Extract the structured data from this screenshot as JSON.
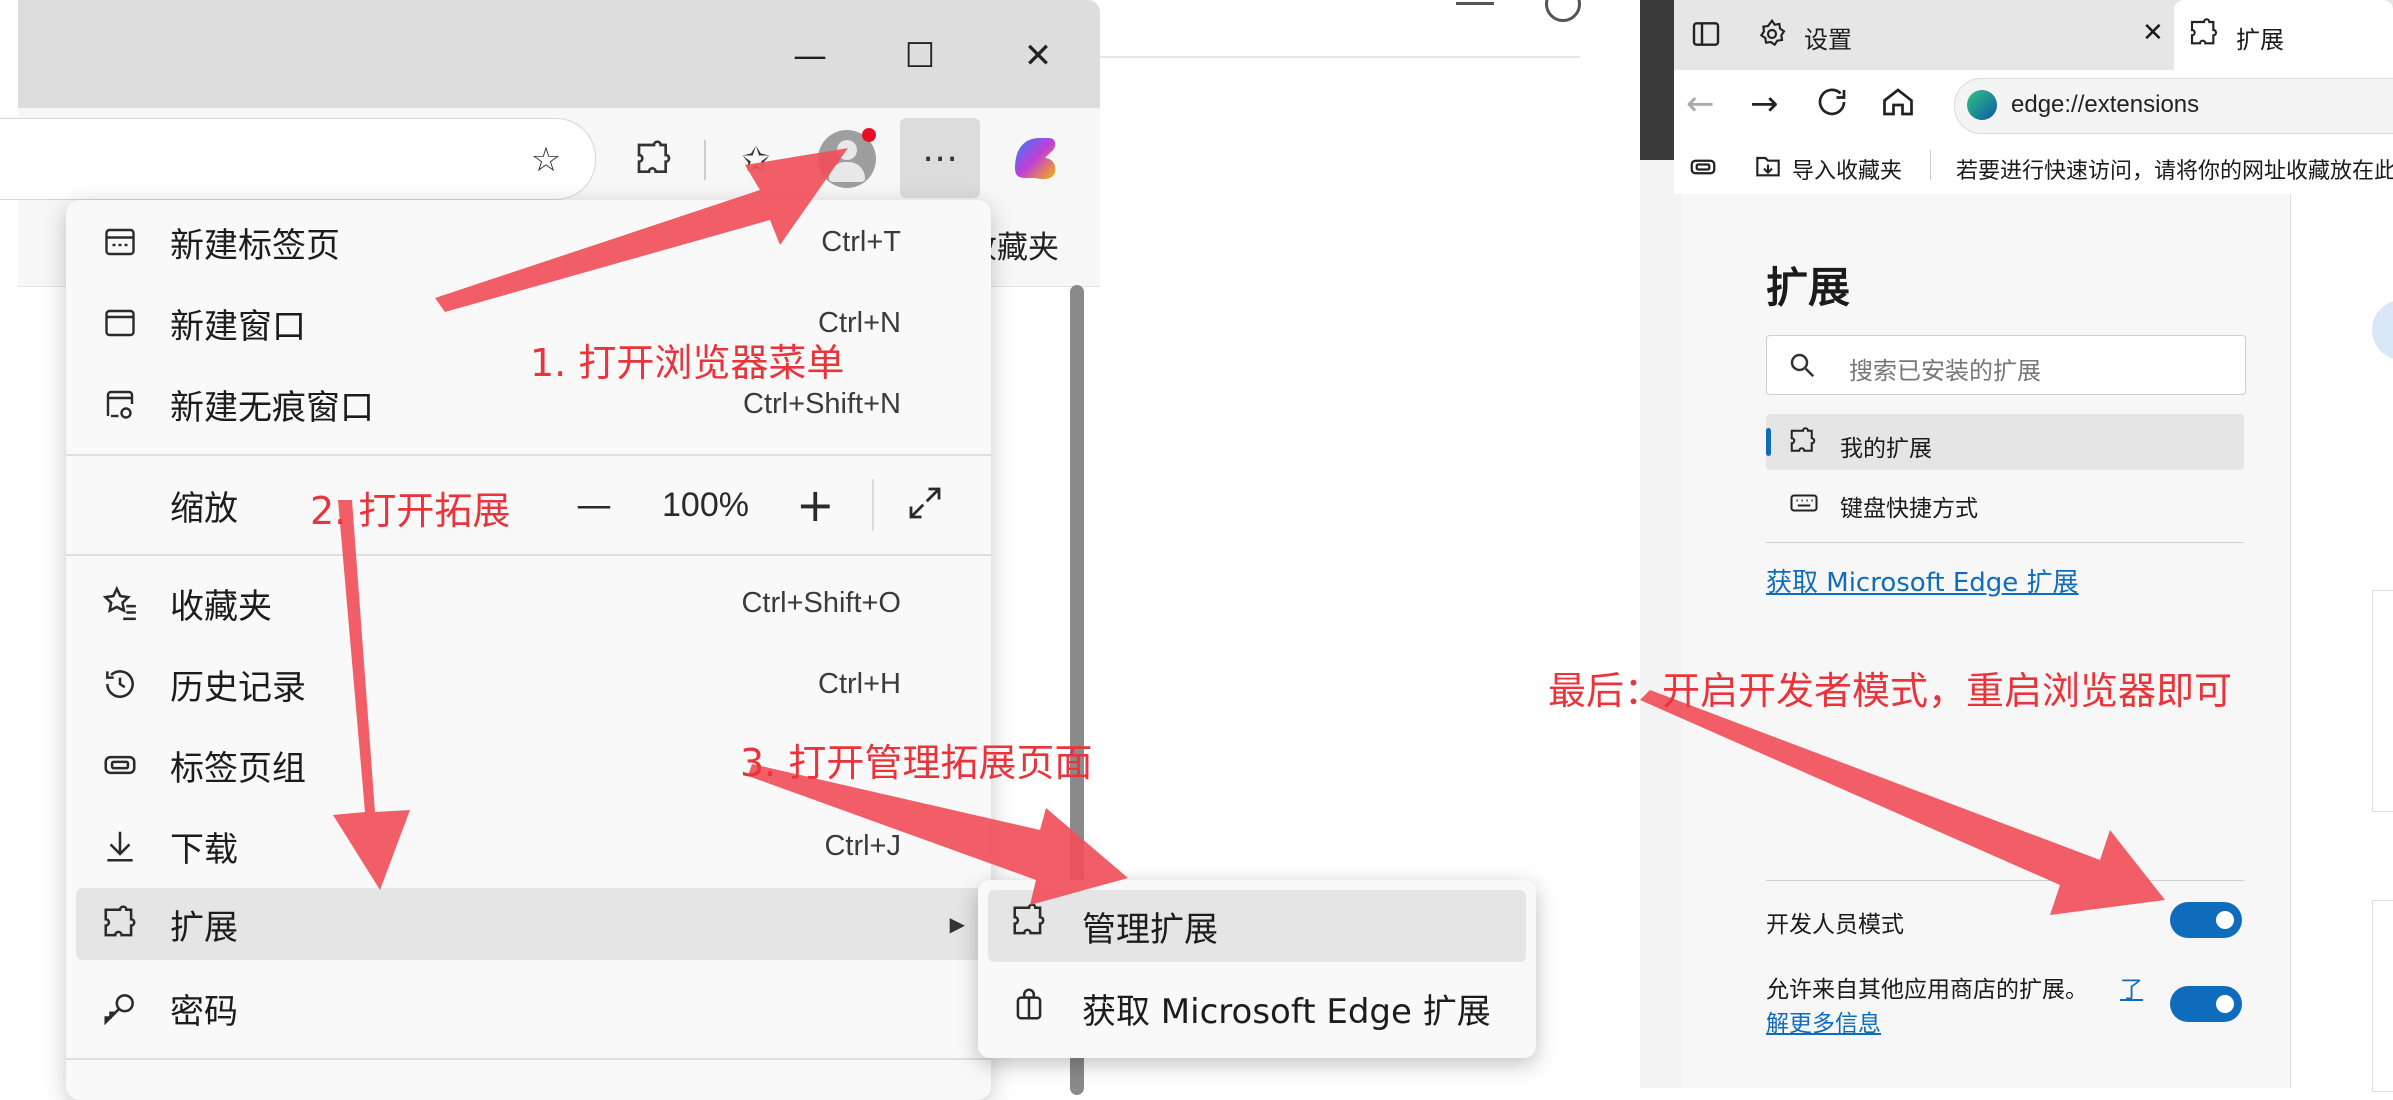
{
  "left_browser": {
    "window_controls": {
      "minimize": "—",
      "maximize": "☐",
      "close": "✕"
    },
    "bookmark_bar_partial": "收藏夹",
    "menu": {
      "items": [
        {
          "label": "新建标签页",
          "shortcut": "Ctrl+T",
          "icon": "new-tab-icon"
        },
        {
          "label": "新建窗口",
          "shortcut": "Ctrl+N",
          "icon": "new-window-icon"
        },
        {
          "label": "新建无痕窗口",
          "shortcut": "Ctrl+Shift+N",
          "icon": "inprivate-window-icon"
        }
      ],
      "zoom": {
        "label": "缩放",
        "minus": "—",
        "value": "100%",
        "plus": "+"
      },
      "items2": [
        {
          "label": "收藏夹",
          "shortcut": "Ctrl+Shift+O",
          "icon": "favorites-icon"
        },
        {
          "label": "历史记录",
          "shortcut": "Ctrl+H",
          "icon": "history-icon"
        },
        {
          "label": "标签页组",
          "shortcut": "",
          "icon": "tab-groups-icon"
        },
        {
          "label": "下载",
          "shortcut": "Ctrl+J",
          "icon": "download-icon"
        },
        {
          "label": "扩展",
          "shortcut": "",
          "icon": "extensions-icon"
        },
        {
          "label": "密码",
          "shortcut": "",
          "icon": "password-icon"
        }
      ]
    },
    "submenu": {
      "items": [
        {
          "label": "管理扩展",
          "icon": "extensions-icon"
        },
        {
          "label": "获取 Microsoft Edge 扩展",
          "icon": "store-bag-icon"
        }
      ]
    },
    "annotations": {
      "step1": "1. 打开浏览器菜单",
      "step2": "2. 打开拓展",
      "step3": "3. 打开管理拓展页面"
    }
  },
  "right_browser": {
    "tabs": [
      {
        "label": "设置",
        "icon": "gear-icon",
        "close": "✕"
      },
      {
        "label": "扩展",
        "icon": "extensions-icon"
      }
    ],
    "address": "edge://extensions",
    "favbar": {
      "import_label": "导入收藏夹",
      "hint": "若要进行快速访问，请将你的网址收藏放在此"
    },
    "page": {
      "title": "扩展",
      "search_placeholder": "搜索已安装的扩展",
      "nav": [
        {
          "label": "我的扩展",
          "icon": "extensions-icon"
        },
        {
          "label": "键盘快捷方式",
          "icon": "keyboard-icon"
        }
      ],
      "get_link": "获取 Microsoft Edge 扩展",
      "dev_mode_label": "开发人员模式",
      "dev_mode_on": true,
      "allow_other_stores_label": "允许来自其他应用商店的扩展。",
      "learn_more_link_1": "了",
      "learn_more_link_2": "解更多信息",
      "allow_other_stores_on": true
    },
    "annotation_final": "最后：开启开发者模式，重启浏览器即可"
  }
}
